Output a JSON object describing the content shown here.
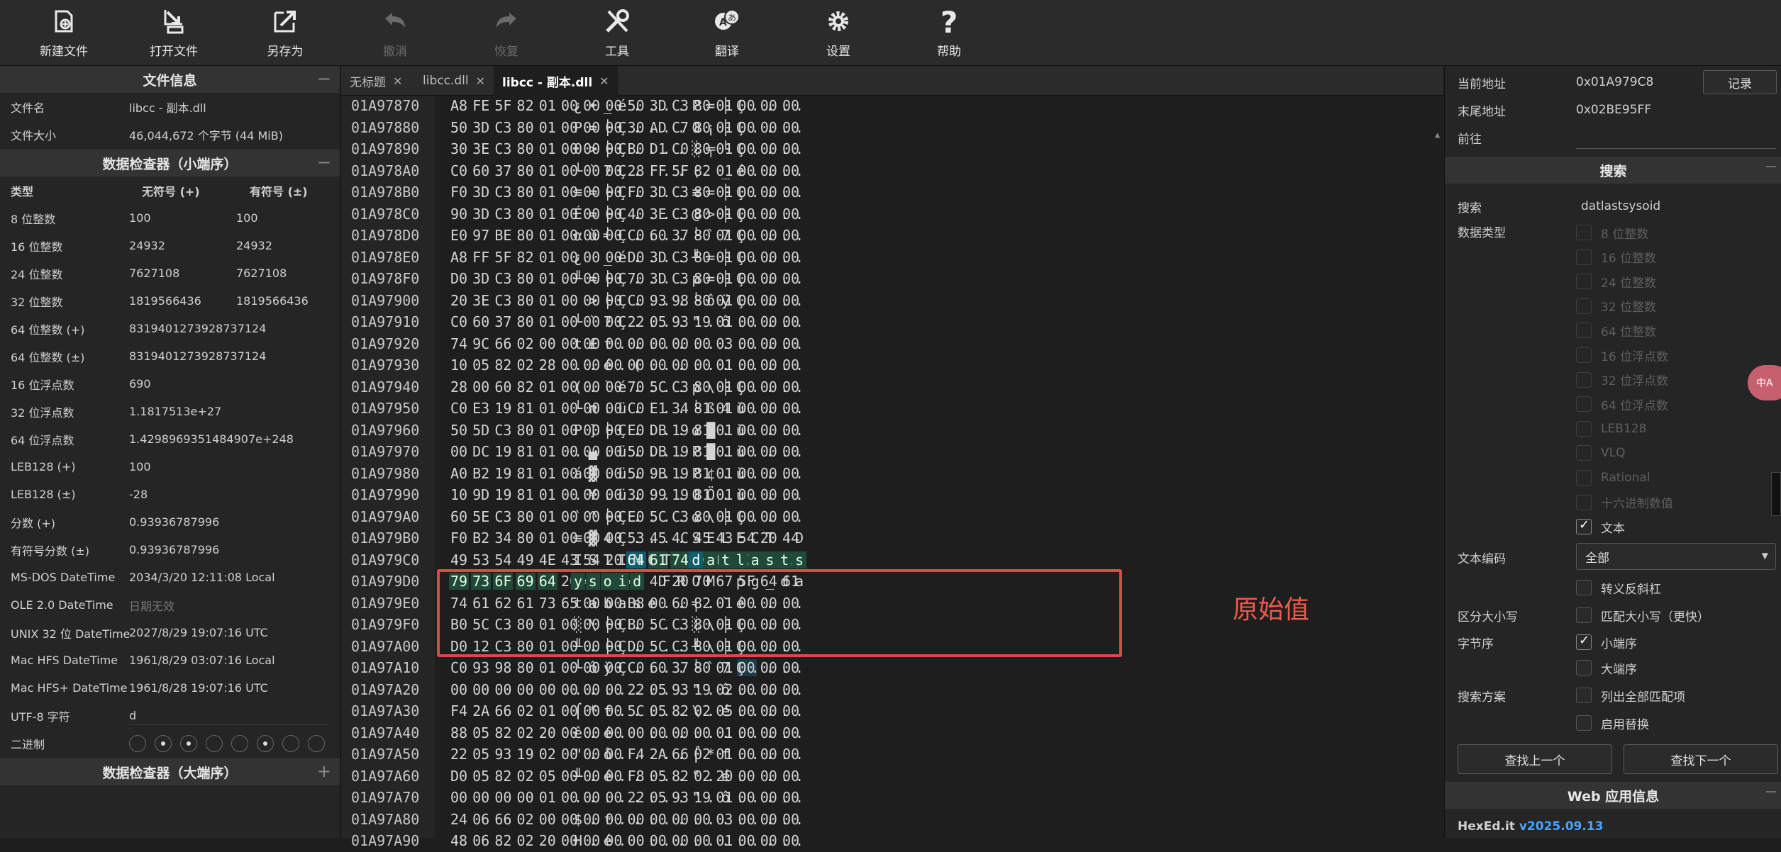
{
  "toolbar": {
    "new": "新建文件",
    "open": "打开文件",
    "saveas": "另存为",
    "undo": "撤消",
    "redo": "恢复",
    "tools": "工具",
    "translate": "翻译",
    "settings": "设置",
    "help": "帮助"
  },
  "fileinfo": {
    "title": "文件信息",
    "name_label": "文件名",
    "name_value": "libcc - 副本.dll",
    "size_label": "文件大小",
    "size_value": "46,044,672 个字节 (44 MiB)"
  },
  "inspector": {
    "title": "数据检查器（小端序）",
    "h_type": "类型",
    "h_unsigned": "无符号 (+)",
    "h_signed": "有符号 (±)",
    "rows": [
      {
        "k": "8 位整数",
        "u": "100",
        "s": "100"
      },
      {
        "k": "16 位整数",
        "u": "24932",
        "s": "24932"
      },
      {
        "k": "24 位整数",
        "u": "7627108",
        "s": "7627108"
      },
      {
        "k": "32 位整数",
        "u": "1819566436",
        "s": "1819566436"
      },
      {
        "k": "64 位整数 (+)",
        "v": "8319401273928737124"
      },
      {
        "k": "64 位整数 (±)",
        "v": "8319401273928737124"
      },
      {
        "k": "16 位浮点数",
        "v": "690"
      },
      {
        "k": "32 位浮点数",
        "v": "1.1817513e+27"
      },
      {
        "k": "64 位浮点数",
        "v": "1.4298969351484907e+248"
      },
      {
        "k": "LEB128 (+)",
        "v": "100"
      },
      {
        "k": "LEB128 (±)",
        "v": "-28"
      },
      {
        "k": "分数 (+)",
        "v": "0.93936787996"
      },
      {
        "k": "有符号分数 (±)",
        "v": "0.93936787996"
      },
      {
        "k": "MS-DOS DateTime",
        "v": "2034/3/20 12:11:08 Local"
      },
      {
        "k": "OLE 2.0 DateTime",
        "v": "日期无效"
      },
      {
        "k": "UNIX 32 位 DateTime",
        "v": "2027/8/29 19:07:16 UTC"
      },
      {
        "k": "Mac HFS DateTime",
        "v": "1961/8/29 03:07:16 Local"
      },
      {
        "k": "Mac HFS+ DateTime",
        "v": "1961/8/28 19:07:16 UTC"
      }
    ],
    "utf8_label": "UTF-8 字符",
    "utf8_value": "d",
    "binary_label": "二进制",
    "binary_bits": [
      0,
      1,
      1,
      0,
      0,
      1,
      0,
      0
    ],
    "big_title": "数据检查器（大端序）"
  },
  "tabs": [
    {
      "label": "无标题",
      "active": false
    },
    {
      "label": "libcc.dll",
      "active": false
    },
    {
      "label": "libcc - 副本.dll",
      "active": true
    }
  ],
  "hex": {
    "rows": [
      {
        "a": "01A97870",
        "b": "A8 FE 5F 82 01 00 00 00 50 3D C3 80 01 00 00 00",
        "t": "¿•_é....P=├Ç...."
      },
      {
        "a": "01A97880",
        "b": "50 3D C3 80 01 00 00 00 30 AD C7 80 01 00 00 00",
        "t": "P=├Ç....0¡├Ç...."
      },
      {
        "a": "01A97890",
        "b": "30 3E C3 80 01 00 00 00 B0 D1 C0 80 01 00 00 00",
        "t": "0>├Ç....░╤└Ç...."
      },
      {
        "a": "01A978A0",
        "b": "C0 60 37 80 01 00 00 00 28 FF 5F 82 01 00 00 00",
        "t": "└`7Ç....( _é...."
      },
      {
        "a": "01A978B0",
        "b": "F0 3D C3 80 01 00 00 00 F0 3D C3 80 01 00 00 00",
        "t": "≡=├Ç....≡=├Ç...."
      },
      {
        "a": "01A978C0",
        "b": "90 3D C3 80 01 00 00 00 40 3E C3 80 01 00 00 00",
        "t": "É=├Ç....@>├Ç...."
      },
      {
        "a": "01A978D0",
        "b": "E0 97 BE 80 01 00 00 00 C0 60 37 80 01 00 00 00",
        "t": "αù╛Ç....└`7Ç...."
      },
      {
        "a": "01A978E0",
        "b": "A8 FF 5F 82 01 00 00 00 D0 3D C3 80 01 00 00 00",
        "t": "¿ _é....╨=├Ç...."
      },
      {
        "a": "01A978F0",
        "b": "D0 3D C3 80 01 00 00 00 70 3D C3 80 01 00 00 00",
        "t": "╨=├Ç....p=├Ç...."
      },
      {
        "a": "01A97900",
        "b": "20 3E C3 80 01 00 00 00 C0 93 98 80 01 00 00 00",
        "t": " >├Ç....└ôÿÇ...."
      },
      {
        "a": "01A97910",
        "b": "C0 60 37 80 01 00 00 00 22 05 93 19 01 00 00 00",
        "t": "└`7Ç....\".ô....."
      },
      {
        "a": "01A97920",
        "b": "74 9C 66 02 00 00 00 00 00 00 00 00 03 00 00 00",
        "t": "t£f............."
      },
      {
        "a": "01A97930",
        "b": "10 05 82 02 28 00 00 00 00 00 00 00 01 00 00 00",
        "t": "..é.(..........."
      },
      {
        "a": "01A97940",
        "b": "28 00 60 82 01 00 00 00 70 5C C3 80 01 00 00 00",
        "t": "(.`é....p\\├Ç...."
      },
      {
        "a": "01A97950",
        "b": "C0 E3 19 81 01 00 00 00 C0 E1 34 81 01 00 00 00",
        "t": "└π.ü....└ß4ü...."
      },
      {
        "a": "01A97960",
        "b": "50 5D C3 80 01 00 00 00 E0 DB 19 81 01 00 00 00",
        "t": "P]├Ç....α█.ü...."
      },
      {
        "a": "01A97970",
        "b": "00 DC 19 81 01 00 00 00 50 DB 19 81 01 00 00 00",
        "t": ".▄.ü....P█.ü...."
      },
      {
        "a": "01A97980",
        "b": "A0 B2 19 81 01 00 00 00 50 9B 19 81 01 00 00 00",
        "t": "á▓.ü....P¢.ü...."
      },
      {
        "a": "01A97990",
        "b": "10 9D 19 81 01 00 00 00 30 99 19 81 01 00 00 00",
        "t": ".¥.ü....0Ö.ü...."
      },
      {
        "a": "01A979A0",
        "b": "60 5E C3 80 01 00 00 00 E0 5C C3 80 01 00 00 00",
        "t": "`^├Ç....α\\├Ç...."
      },
      {
        "a": "01A979B0",
        "b": "F0 B2 34 80 01 00 00 00 53 45 4C 45 43 54 20 44",
        "t": "≡▓4Ç....SELECT D"
      },
      {
        "a": "01A979C0",
        "b": "49 53 54 49 4E 43 54 20 64 61 74 6C 61 73 74 73",
        "t": "ISTINCT datlasts"
      },
      {
        "a": "01A979D0",
        "b": "79 73 6F 69 64 20 46 52 4F 4D 20 70 67 5F 64 61",
        "t": "ysoid FROM pg_da"
      },
      {
        "a": "01A979E0",
        "b": "74 61 62 61 73 65 00 00 B8 00 60 82 01 00 00 00",
        "t": "tabase..╕.`é...."
      },
      {
        "a": "01A979F0",
        "b": "B0 5C C3 80 01 00 00 00 B0 5C C3 80 01 00 00 00",
        "t": "░\\├Ç....░\\├Ç...."
      },
      {
        "a": "01A97A00",
        "b": "D0 12 C3 80 01 00 00 00 D0 5C C3 80 01 00 00 00",
        "t": "╨.├Ç....╨\\├Ç...."
      },
      {
        "a": "01A97A10",
        "b": "C0 93 98 80 01 00 00 00 C0 60 37 80 01 00 00 00",
        "t": "└ôÿÇ....└`7Ç...."
      },
      {
        "a": "01A97A20",
        "b": "00 00 00 00 00 00 00 00 22 05 93 19 02 00 00 00",
        "t": "........\".ô....."
      },
      {
        "a": "01A97A30",
        "b": "F4 2A 66 02 01 00 00 00 5C 05 82 02 05 00 00 00",
        "t": "⌠*f.....\\.é....."
      },
      {
        "a": "01A97A40",
        "b": "88 05 82 02 20 00 00 00 00 00 00 00 01 00 00 00",
        "t": "ê.é. ..........."
      },
      {
        "a": "01A97A50",
        "b": "22 05 93 19 02 00 00 00 F4 2A 66 02 01 00 00 00",
        "t": "\".ô.....⌠*f....."
      },
      {
        "a": "01A97A60",
        "b": "D0 05 82 02 05 00 00 00 F8 05 82 02 20 00 00 00",
        "t": "╨.é.....°.é. ..."
      },
      {
        "a": "01A97A70",
        "b": "00 00 00 00 01 00 00 00 22 05 93 19 01 00 00 00",
        "t": "........\".ô....."
      },
      {
        "a": "01A97A80",
        "b": "24 06 66 02 00 00 00 00 00 00 00 00 03 00 00 00",
        "t": "$.f............."
      },
      {
        "a": "01A97A90",
        "b": "48 06 82 02 20 00 00 00 00 00 00 00 01 00 00 00",
        "t": "H.é. ..........."
      }
    ]
  },
  "annotation": "原始值",
  "right": {
    "cur_addr_label": "当前地址",
    "cur_addr_value": "0x01A979C8",
    "record_btn": "记录",
    "end_addr_label": "末尾地址",
    "end_addr_value": "0x02BE95FF",
    "goto_label": "前往",
    "search_title": "搜索",
    "search_label": "搜索",
    "search_value": "datlastsysoid",
    "dtype_label": "数据类型",
    "dtypes": [
      "8 位整数",
      "16 位整数",
      "24 位整数",
      "32 位整数",
      "64 位整数",
      "16 位浮点数",
      "32 位浮点数",
      "64 位浮点数",
      "LEB128",
      "VLQ",
      "Rational",
      "十六进制数值"
    ],
    "text_opt": "文本",
    "encoding_label": "文本编码",
    "encoding_value": "全部",
    "escape_opt": "转义反斜杠",
    "case_label": "区分大小写",
    "case_opt": "匹配大小写（更快）",
    "endian_label": "字节序",
    "little_opt": "小端序",
    "big_opt": "大端序",
    "scheme_label": "搜索方案",
    "listall_opt": "列出全部匹配项",
    "replace_opt": "启用替换",
    "prev_btn": "查找上一个",
    "next_btn": "查找下一个",
    "web_title": "Web 应用信息",
    "app_name": "HexEd.it",
    "app_version": "v2025.09.13"
  },
  "float_badge": "中A"
}
